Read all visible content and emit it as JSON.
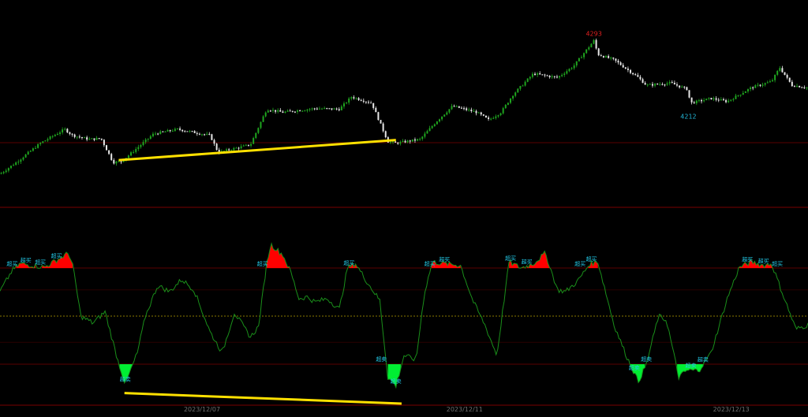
{
  "colors": {
    "background": "#000000",
    "candle_up": "#1fa51f",
    "candle_down": "#e8e8e8",
    "oscillator": "#1a8f1a",
    "overbought_fill": "#ff0000",
    "oversold_fill": "#00ee33",
    "trendline": "#ffe000",
    "separator": "#7a0000",
    "level_line": "#5a0000",
    "zero_line": "#8a7a00",
    "high_label": "#e02020",
    "low_label": "#22b4d4",
    "signal_label": "#22c8e6"
  },
  "chart_data": [
    {
      "type": "candlestick",
      "title": "",
      "annotations": {
        "high_label": "4293",
        "low_label": "4212"
      },
      "close_path": [
        [
          0,
          4120
        ],
        [
          0.02,
          4135
        ],
        [
          0.05,
          4160
        ],
        [
          0.08,
          4178
        ],
        [
          0.09,
          4170
        ],
        [
          0.11,
          4165
        ],
        [
          0.125,
          4166
        ],
        [
          0.14,
          4135
        ],
        [
          0.15,
          4136
        ],
        [
          0.19,
          4172
        ],
        [
          0.22,
          4178
        ],
        [
          0.26,
          4170
        ],
        [
          0.27,
          4148
        ],
        [
          0.31,
          4158
        ],
        [
          0.33,
          4204
        ],
        [
          0.35,
          4200
        ],
        [
          0.39,
          4205
        ],
        [
          0.42,
          4204
        ],
        [
          0.435,
          4220
        ],
        [
          0.46,
          4212
        ],
        [
          0.48,
          4162
        ],
        [
          0.49,
          4160
        ],
        [
          0.52,
          4165
        ],
        [
          0.54,
          4188
        ],
        [
          0.56,
          4208
        ],
        [
          0.59,
          4200
        ],
        [
          0.605,
          4190
        ],
        [
          0.62,
          4200
        ],
        [
          0.635,
          4223
        ],
        [
          0.66,
          4250
        ],
        [
          0.69,
          4245
        ],
        [
          0.71,
          4260
        ],
        [
          0.74,
          4275
        ],
        [
          0.735,
          4293
        ],
        [
          0.76,
          4268
        ],
        [
          0.79,
          4245
        ],
        [
          0.8,
          4235
        ],
        [
          0.83,
          4238
        ],
        [
          0.85,
          4230
        ],
        [
          0.855,
          4212
        ],
        [
          0.88,
          4218
        ],
        [
          0.9,
          4214
        ],
        [
          0.93,
          4232
        ],
        [
          0.955,
          4240
        ],
        [
          0.965,
          4258
        ],
        [
          0.98,
          4235
        ],
        [
          1.0,
          4232
        ]
      ],
      "trendline": {
        "start": [
          0.147,
          4138
        ],
        "end": [
          0.49,
          4164
        ]
      },
      "ylim": [
        4085,
        4320
      ]
    },
    {
      "type": "line",
      "name": "",
      "levels": {
        "overbought": 55,
        "oversold": -55,
        "zero": 0
      },
      "ylim": [
        -100,
        100
      ],
      "values": [
        [
          0,
          28
        ],
        [
          0.015,
          52
        ],
        [
          0.025,
          60
        ],
        [
          0.04,
          58
        ],
        [
          0.055,
          56
        ],
        [
          0.07,
          64
        ],
        [
          0.085,
          72
        ],
        [
          0.09,
          58
        ],
        [
          0.1,
          0
        ],
        [
          0.115,
          -8
        ],
        [
          0.13,
          5
        ],
        [
          0.145,
          -48
        ],
        [
          0.155,
          -78
        ],
        [
          0.17,
          -42
        ],
        [
          0.18,
          0
        ],
        [
          0.195,
          35
        ],
        [
          0.21,
          28
        ],
        [
          0.225,
          42
        ],
        [
          0.24,
          30
        ],
        [
          0.26,
          -18
        ],
        [
          0.275,
          -42
        ],
        [
          0.29,
          4
        ],
        [
          0.31,
          -24
        ],
        [
          0.32,
          -12
        ],
        [
          0.33,
          60
        ],
        [
          0.335,
          82
        ],
        [
          0.34,
          78
        ],
        [
          0.35,
          70
        ],
        [
          0.36,
          50
        ],
        [
          0.37,
          20
        ],
        [
          0.38,
          22
        ],
        [
          0.39,
          16
        ],
        [
          0.405,
          20
        ],
        [
          0.42,
          8
        ],
        [
          0.43,
          55
        ],
        [
          0.44,
          60
        ],
        [
          0.455,
          38
        ],
        [
          0.47,
          18
        ],
        [
          0.48,
          -70
        ],
        [
          0.49,
          -80
        ],
        [
          0.5,
          -45
        ],
        [
          0.515,
          -50
        ],
        [
          0.525,
          25
        ],
        [
          0.535,
          62
        ],
        [
          0.55,
          60
        ],
        [
          0.57,
          58
        ],
        [
          0.585,
          18
        ],
        [
          0.6,
          -10
        ],
        [
          0.615,
          -45
        ],
        [
          0.63,
          62
        ],
        [
          0.645,
          55
        ],
        [
          0.66,
          60
        ],
        [
          0.675,
          72
        ],
        [
          0.69,
          30
        ],
        [
          0.7,
          28
        ],
        [
          0.715,
          40
        ],
        [
          0.73,
          60
        ],
        [
          0.74,
          62
        ],
        [
          0.76,
          -10
        ],
        [
          0.775,
          -45
        ],
        [
          0.79,
          -75
        ],
        [
          0.8,
          -55
        ],
        [
          0.815,
          0
        ],
        [
          0.825,
          -5
        ],
        [
          0.84,
          -70
        ],
        [
          0.85,
          -62
        ],
        [
          0.865,
          -62
        ],
        [
          0.88,
          -42
        ],
        [
          0.9,
          20
        ],
        [
          0.915,
          56
        ],
        [
          0.93,
          62
        ],
        [
          0.945,
          58
        ],
        [
          0.955,
          60
        ],
        [
          0.97,
          22
        ],
        [
          0.985,
          -15
        ],
        [
          1.0,
          -10
        ]
      ],
      "signal_tags": [
        {
          "x": 0.015,
          "text": "超买"
        },
        {
          "x": 0.032,
          "text": "超买"
        },
        {
          "x": 0.05,
          "text": "超买"
        },
        {
          "x": 0.07,
          "text": "超买"
        },
        {
          "x": 0.325,
          "text": "超买"
        },
        {
          "x": 0.432,
          "text": "超买"
        },
        {
          "x": 0.532,
          "text": "超买"
        },
        {
          "x": 0.55,
          "text": "超买"
        },
        {
          "x": 0.632,
          "text": "超买"
        },
        {
          "x": 0.652,
          "text": "超买"
        },
        {
          "x": 0.718,
          "text": "超买"
        },
        {
          "x": 0.732,
          "text": "超买"
        },
        {
          "x": 0.925,
          "text": "超买"
        },
        {
          "x": 0.945,
          "text": "超买"
        },
        {
          "x": 0.962,
          "text": "超买"
        },
        {
          "x": 0.155,
          "text": "超卖"
        },
        {
          "x": 0.472,
          "text": "超卖"
        },
        {
          "x": 0.49,
          "text": "超卖"
        },
        {
          "x": 0.785,
          "text": "超卖"
        },
        {
          "x": 0.8,
          "text": "超卖"
        },
        {
          "x": 0.855,
          "text": "超卖"
        },
        {
          "x": 0.87,
          "text": "超卖"
        }
      ],
      "trendline": {
        "start": [
          0.154,
          -88
        ],
        "end": [
          0.497,
          -100
        ]
      }
    }
  ],
  "x_axis": {
    "date_labels": [
      {
        "x": 0.25,
        "text": "2023/12/07"
      },
      {
        "x": 0.575,
        "text": "2023/12/11"
      },
      {
        "x": 0.905,
        "text": "2023/12/13"
      }
    ]
  }
}
